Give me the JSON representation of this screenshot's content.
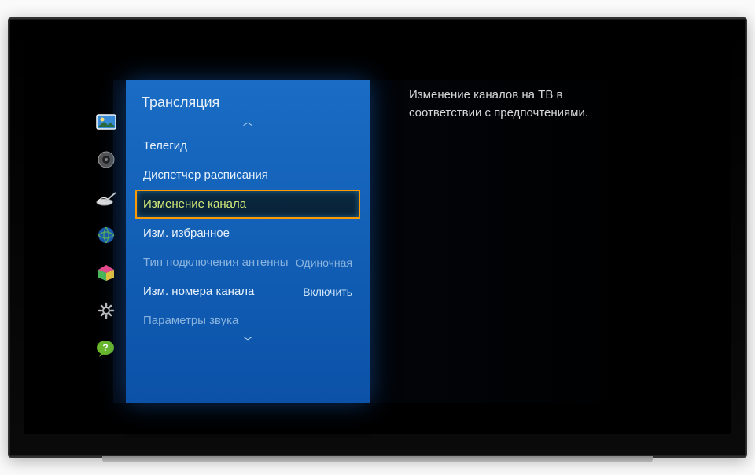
{
  "panel": {
    "title": "Трансляция",
    "items": [
      {
        "label": "Телегид",
        "value": "",
        "disabled": false,
        "selected": false
      },
      {
        "label": "Диспетчер расписания",
        "value": "",
        "disabled": false,
        "selected": false
      },
      {
        "label": "Изменение канала",
        "value": "",
        "disabled": false,
        "selected": true
      },
      {
        "label": "Изм. избранное",
        "value": "",
        "disabled": false,
        "selected": false
      },
      {
        "label": "Тип подключения антенны",
        "value": "Одиночная",
        "disabled": true,
        "selected": false
      },
      {
        "label": "Изм. номера канала",
        "value": "Включить",
        "disabled": false,
        "selected": false
      },
      {
        "label": "Параметры звука",
        "value": "",
        "disabled": true,
        "selected": false
      }
    ]
  },
  "description": "Изменение каналов на ТВ в соответствии с предпочтениями.",
  "sidebar_icons": [
    "picture-icon",
    "sound-icon",
    "broadcast-icon",
    "network-icon",
    "smarthub-icon",
    "system-icon",
    "support-icon"
  ]
}
